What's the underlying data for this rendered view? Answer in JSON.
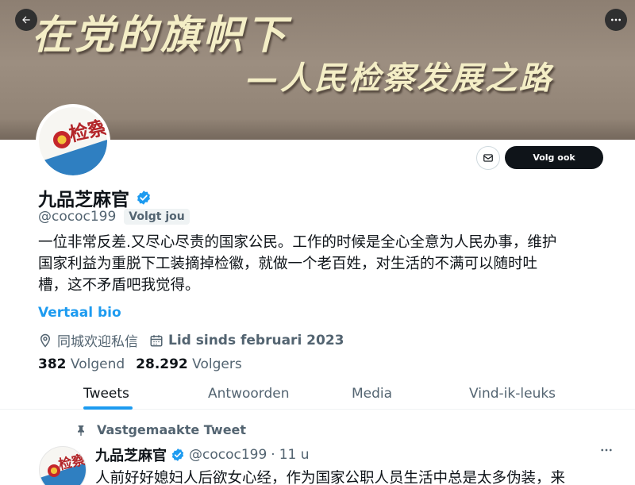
{
  "banner": {
    "line1": "在党的旗帜下",
    "line2": "—人民检察发展之路"
  },
  "header": {
    "back_icon": "arrow-left-icon",
    "more_icon": "more-horizontal-icon"
  },
  "avatar": {
    "text": "检察"
  },
  "actions": {
    "message_icon": "envelope-icon",
    "follow_label": "Volg ook"
  },
  "profile": {
    "display_name": "九品芝麻官",
    "handle": "@cococ199",
    "follows_you": "Volgt jou",
    "bio_line1": "一位非常反差.又尽心尽责的国家公民。工作的时候是全心全意为人民办事，维护",
    "bio_line2": "国家利益为重脱下工装摘掉检徽，就做一个老百姓，对生活的不满可以随时吐",
    "bio_line3": "槽，这不矛盾吧我觉得。",
    "translate_label": "Vertaal bio",
    "location": "同城欢迎私信",
    "joined": "Lid sinds februari 2023",
    "following_count": "382",
    "following_label": "Volgend",
    "followers_count": "28.292",
    "followers_label": "Volgers"
  },
  "tabs": [
    {
      "label": "Tweets"
    },
    {
      "label": "Antwoorden"
    },
    {
      "label": "Media"
    },
    {
      "label": "Vind-ik-leuks"
    }
  ],
  "pinned_tweet": {
    "pinned_label": "Vastgemaakte Tweet",
    "name": "九品芝麻官",
    "handle": "@cococ199",
    "separator": "·",
    "time": "11 u",
    "text": "人前好好媳妇人后欲女心经，作为国家公职人员生活中总是太多伪装，来"
  },
  "colors": {
    "accent": "#1d9bf0",
    "text_primary": "#0f1419",
    "text_secondary": "#536471"
  }
}
